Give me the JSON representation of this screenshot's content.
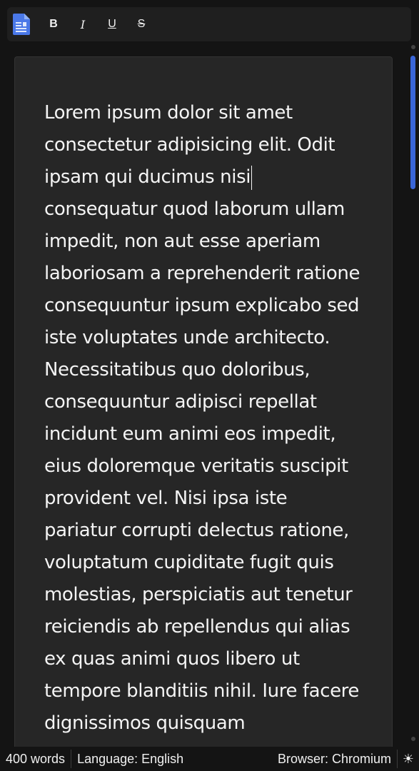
{
  "toolbar": {
    "app_icon": "document-icon",
    "bold_label": "B",
    "italic_label": "I",
    "underline_label": "U",
    "strike_label": "S"
  },
  "editor": {
    "text_before_caret": "Lorem ipsum dolor sit amet consectetur adipisicing elit. Odit ipsam qui ducimus nisi",
    "text_after_caret": " consequatur quod laborum ullam impedit, non aut esse aperiam laboriosam a reprehenderit ratione consequuntur ipsum explicabo sed iste voluptates unde architecto. Necessitatibus quo doloribus, consequuntur adipisci repellat incidunt eum animi eos impedit, eius doloremque veritatis suscipit provident vel. Nisi ipsa iste pariatur corrupti delectus ratione, voluptatum cupiditate fugit quis molestias, perspiciatis aut tenetur reiciendis ab repellendus qui alias ex quas animi quos libero ut tempore blanditiis nihil. Iure facere dignissimos quisquam"
  },
  "statusbar": {
    "word_count": "400 words",
    "language": "Language: English",
    "browser": "Browser: Chromium",
    "theme_icon": "☀"
  },
  "colors": {
    "accent": "#3a66d8",
    "background": "#141414",
    "editor_bg": "#262626",
    "toolbar_bg": "#1f1f1f"
  }
}
